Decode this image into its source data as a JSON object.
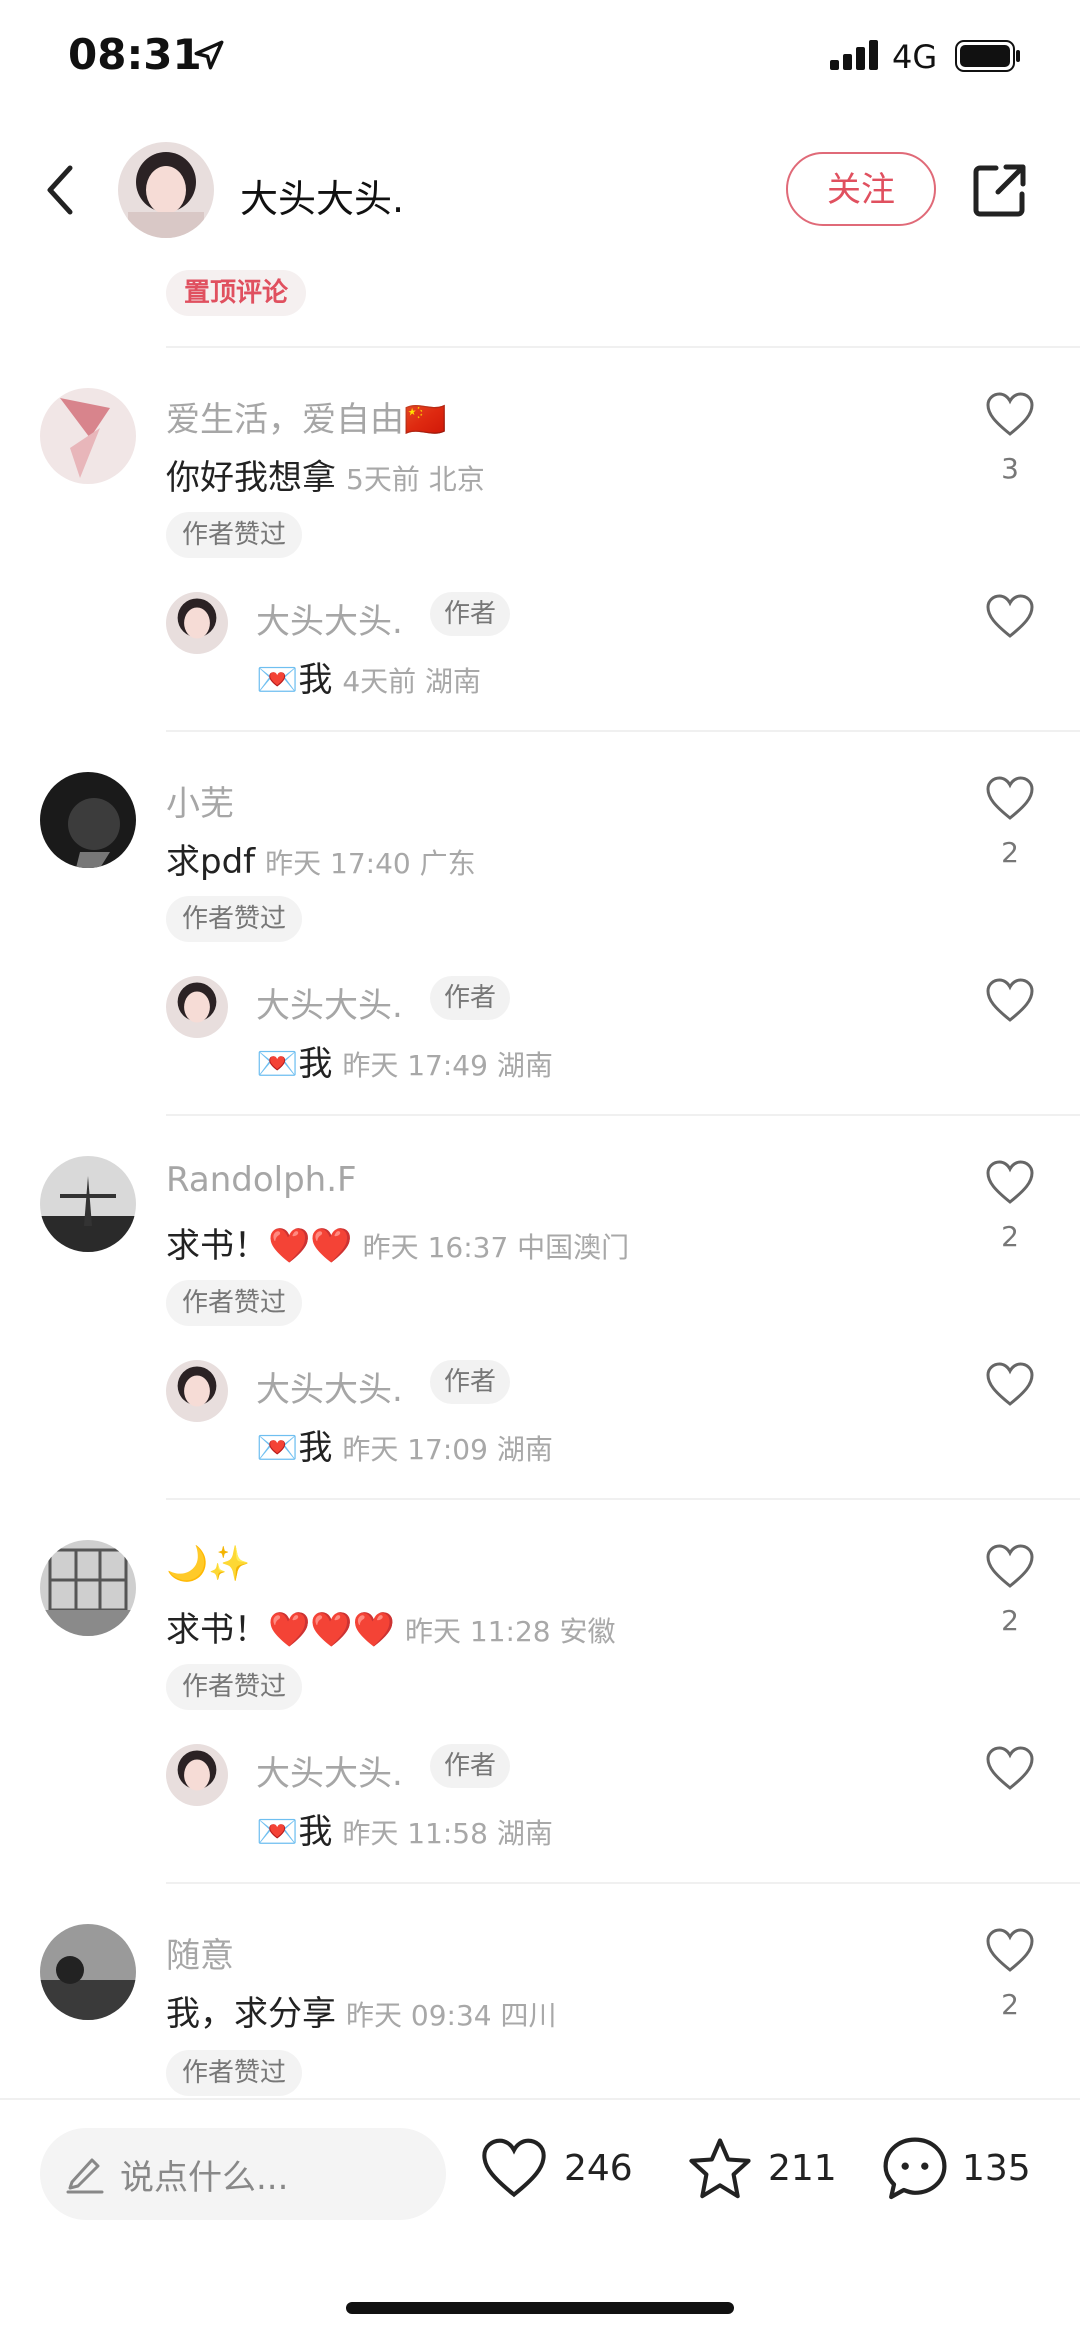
{
  "status_bar": {
    "time": "08:31",
    "network": "4G"
  },
  "header": {
    "author_name": "大头大头.",
    "follow_label": "关注"
  },
  "pinned_tag": "置顶评论",
  "comments": [
    {
      "user": "爱生活，爱自由🇨🇳",
      "text": "你好我想拿",
      "meta": "5天前 北京",
      "likes": "3",
      "tag": "作者赞过",
      "reply": {
        "user": "大头大头.",
        "author_tag": "作者",
        "text": "💌我",
        "meta": "4天前 湖南"
      }
    },
    {
      "user": "小芜",
      "text": "求pdf",
      "meta": "昨天 17:40 广东",
      "likes": "2",
      "tag": "作者赞过",
      "reply": {
        "user": "大头大头.",
        "author_tag": "作者",
        "text": "💌我",
        "meta": "昨天 17:49 湖南"
      }
    },
    {
      "user": "Randolph.F",
      "text": "求书！❤️❤️",
      "meta": "昨天 16:37 中国澳门",
      "likes": "2",
      "tag": "作者赞过",
      "reply": {
        "user": "大头大头.",
        "author_tag": "作者",
        "text": "💌我",
        "meta": "昨天 17:09 湖南"
      }
    },
    {
      "user": "🌙✨",
      "text": "求书！❤️❤️❤️",
      "meta": "昨天 11:28 安徽",
      "likes": "2",
      "tag": "作者赞过",
      "reply": {
        "user": "大头大头.",
        "author_tag": "作者",
        "text": "💌我",
        "meta": "昨天 11:58 湖南"
      }
    },
    {
      "user": "随意",
      "text": "我，求分享",
      "meta": "昨天 09:34 四川",
      "likes": "2",
      "tag": "作者赞过"
    }
  ],
  "bottom_bar": {
    "input_placeholder": "说点什么...",
    "like_count": "246",
    "collect_count": "211",
    "comment_count": "135"
  },
  "icons": {
    "back": "chevron-left-icon",
    "share": "share-icon",
    "like": "heart-icon",
    "collect": "star-icon",
    "comment": "comment-bubble-icon",
    "edit": "pencil-icon"
  },
  "colors": {
    "accent": "#e0505f",
    "muted_text": "#a8a8a8"
  }
}
